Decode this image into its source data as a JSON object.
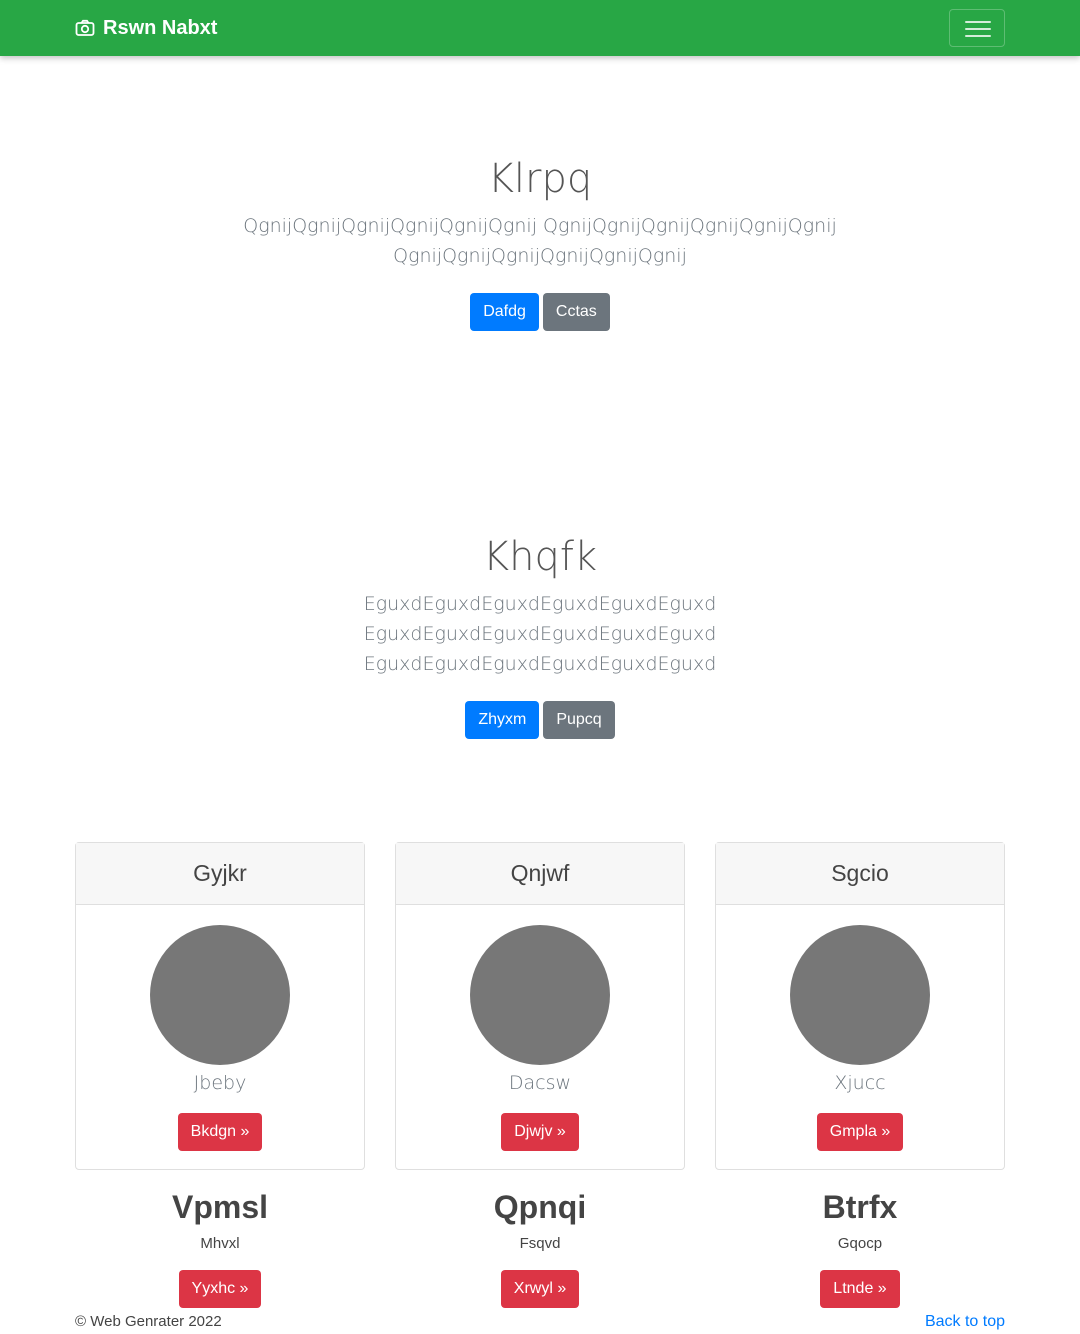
{
  "navbar": {
    "brand": "Rswn Nabxt",
    "brand_icon": "camera-icon",
    "toggler_icon": "hamburger-icon",
    "color": "#28a745"
  },
  "hero1": {
    "title": "Klrpq",
    "text_line1": "QgnijQgnijQgnijQgnijQgnijQgnij QgnijQgnijQgnijQgnijQgnijQgnij",
    "text_line2": "QgnijQgnijQgnijQgnijQgnijQgnij",
    "primary_btn": "Dafdg",
    "secondary_btn": "Cctas"
  },
  "hero2": {
    "title": "Khqfk",
    "text_line1": "EguxdEguxdEguxdEguxdEguxdEguxd",
    "text_line2": "EguxdEguxdEguxdEguxdEguxdEguxd",
    "text_line3": "EguxdEguxdEguxdEguxdEguxdEguxd",
    "primary_btn": "Zhyxm",
    "secondary_btn": "Pupcq"
  },
  "cards": [
    {
      "header": "Gyjkr",
      "text": "Jbeby",
      "button": "Bkdgn »"
    },
    {
      "header": "Qnjwf",
      "text": "Dacsw",
      "button": "Djwjv »"
    },
    {
      "header": "Sgcio",
      "text": "Xjucc",
      "button": "Gmpla »"
    }
  ],
  "columns": [
    {
      "title": "Vpmsl",
      "text": "Mhvxl",
      "button": "Yyxhc »"
    },
    {
      "title": "Qpnqi",
      "text": "Fsqvd",
      "button": "Xrwyl »"
    },
    {
      "title": "Btrfx",
      "text": "Gqocp",
      "button": "Ltnde »"
    }
  ],
  "footer": {
    "copyright": "© Web Genrater 2022",
    "back_to_top": "Back to top"
  },
  "colors": {
    "primary": "#007bff",
    "secondary": "#6c757d",
    "danger": "#dc3545",
    "avatar": "#777777"
  }
}
